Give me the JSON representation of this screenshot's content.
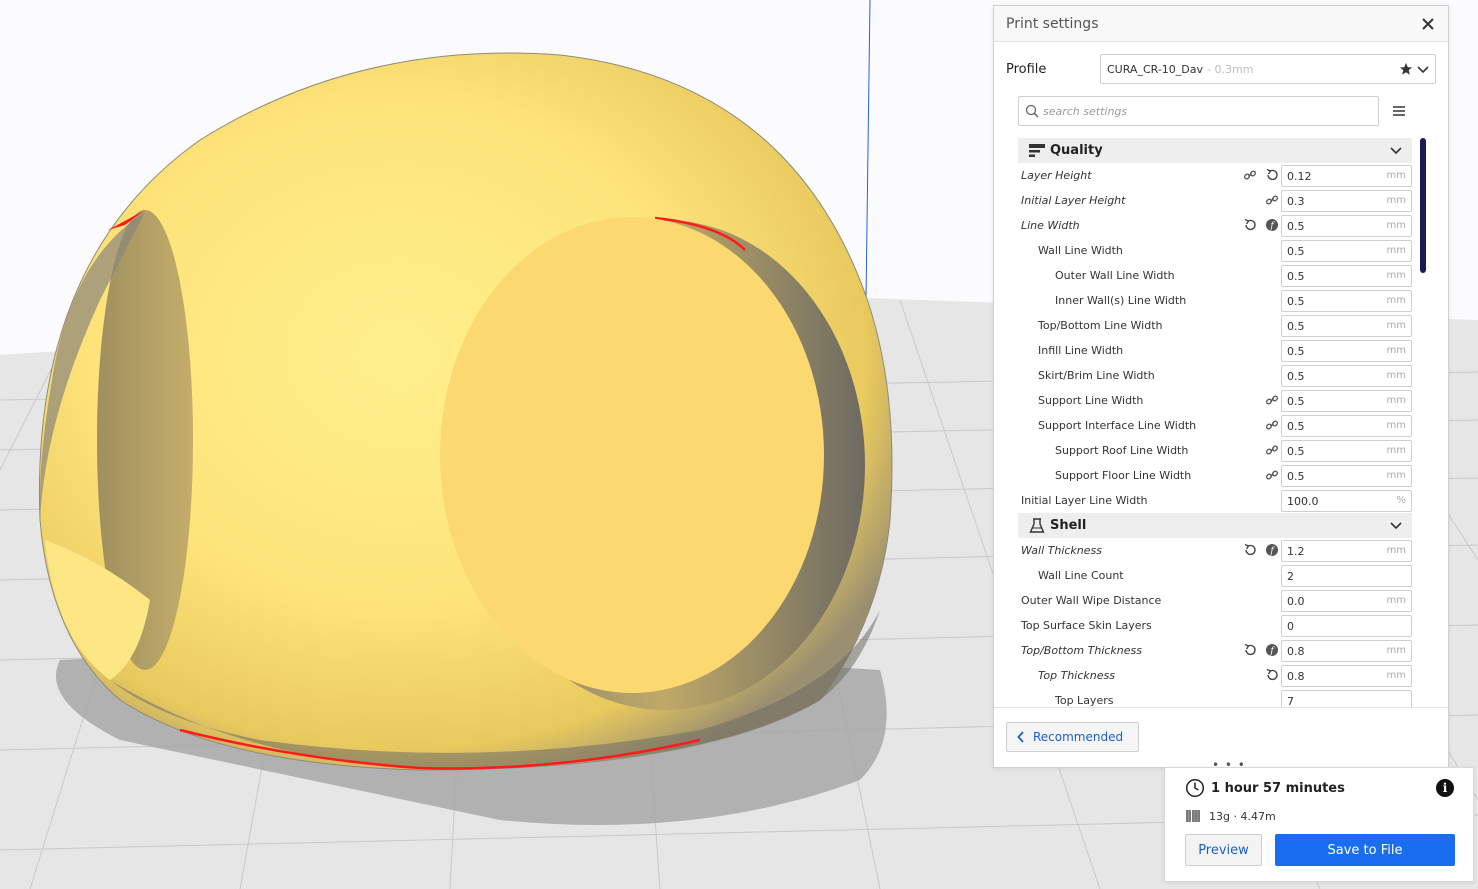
{
  "panel": {
    "title": "Print settings",
    "profile_label": "Profile",
    "profile_name": "CURA_CR-10_Dav",
    "profile_sub": "- 0.3mm",
    "search_placeholder": "search settings",
    "recommended_label": "Recommended"
  },
  "categories": [
    {
      "label": "Quality",
      "icon": "quality-icon",
      "rows": [
        {
          "label": "Layer Height",
          "italic": true,
          "indent": 0,
          "icons": [
            "link-icon",
            "reset-icon"
          ],
          "value": "0.12",
          "unit": "mm"
        },
        {
          "label": "Initial Layer Height",
          "italic": true,
          "indent": 0,
          "icons": [
            "link-icon"
          ],
          "value": "0.3",
          "unit": "mm"
        },
        {
          "label": "Line Width",
          "italic": true,
          "indent": 0,
          "icons": [
            "reset-icon",
            "function-icon"
          ],
          "value": "0.5",
          "unit": "mm"
        },
        {
          "label": "Wall Line Width",
          "italic": false,
          "indent": 1,
          "icons": [],
          "value": "0.5",
          "unit": "mm"
        },
        {
          "label": "Outer Wall Line Width",
          "italic": false,
          "indent": 2,
          "icons": [],
          "value": "0.5",
          "unit": "mm"
        },
        {
          "label": "Inner Wall(s) Line Width",
          "italic": false,
          "indent": 2,
          "icons": [],
          "value": "0.5",
          "unit": "mm"
        },
        {
          "label": "Top/Bottom Line Width",
          "italic": false,
          "indent": 1,
          "icons": [],
          "value": "0.5",
          "unit": "mm"
        },
        {
          "label": "Infill Line Width",
          "italic": false,
          "indent": 1,
          "icons": [],
          "value": "0.5",
          "unit": "mm"
        },
        {
          "label": "Skirt/Brim Line Width",
          "italic": false,
          "indent": 1,
          "icons": [],
          "value": "0.5",
          "unit": "mm"
        },
        {
          "label": "Support Line Width",
          "italic": false,
          "indent": 1,
          "icons": [
            "link-icon"
          ],
          "value": "0.5",
          "unit": "mm"
        },
        {
          "label": "Support Interface Line Width",
          "italic": false,
          "indent": 1,
          "icons": [
            "link-icon"
          ],
          "value": "0.5",
          "unit": "mm"
        },
        {
          "label": "Support Roof Line Width",
          "italic": false,
          "indent": 2,
          "icons": [
            "link-icon"
          ],
          "value": "0.5",
          "unit": "mm"
        },
        {
          "label": "Support Floor Line Width",
          "italic": false,
          "indent": 2,
          "icons": [
            "link-icon"
          ],
          "value": "0.5",
          "unit": "mm"
        },
        {
          "label": "Initial Layer Line Width",
          "italic": false,
          "indent": 0,
          "icons": [],
          "value": "100.0",
          "unit": "%"
        }
      ]
    },
    {
      "label": "Shell",
      "icon": "shell-icon",
      "rows": [
        {
          "label": "Wall Thickness",
          "italic": true,
          "indent": 0,
          "icons": [
            "reset-icon",
            "function-icon"
          ],
          "value": "1.2",
          "unit": "mm"
        },
        {
          "label": "Wall Line Count",
          "italic": false,
          "indent": 1,
          "icons": [],
          "value": "2",
          "unit": ""
        },
        {
          "label": "Outer Wall Wipe Distance",
          "italic": false,
          "indent": 0,
          "icons": [],
          "value": "0.0",
          "unit": "mm"
        },
        {
          "label": "Top Surface Skin Layers",
          "italic": false,
          "indent": 0,
          "icons": [],
          "value": "0",
          "unit": ""
        },
        {
          "label": "Top/Bottom Thickness",
          "italic": true,
          "indent": 0,
          "icons": [
            "reset-icon",
            "function-icon"
          ],
          "value": "0.8",
          "unit": "mm"
        },
        {
          "label": "Top Thickness",
          "italic": true,
          "indent": 1,
          "icons": [
            "reset-icon"
          ],
          "value": "0.8",
          "unit": "mm"
        },
        {
          "label": "Top Layers",
          "italic": false,
          "indent": 2,
          "icons": [],
          "value": "7",
          "unit": ""
        }
      ]
    }
  ],
  "job": {
    "time": "1 hour 57 minutes",
    "material": "13g · 4.47m",
    "preview_label": "Preview",
    "save_label": "Save to File"
  },
  "colors": {
    "model_yellow": "#fde37a",
    "accent_blue": "#196ef0",
    "link_blue": "#1961c7",
    "scrollbar": "#1a1a55"
  }
}
